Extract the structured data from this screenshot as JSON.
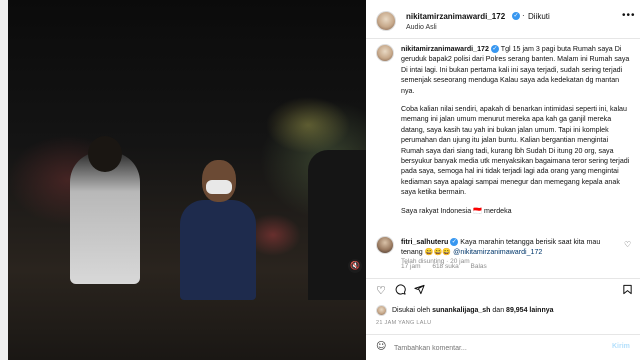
{
  "post": {
    "username": "nikitamirzanimawardi_172",
    "follow_label": "Diikuti",
    "audio_label": "Audio Asli",
    "more_label": "•••"
  },
  "caption": {
    "username": "nikitamirzanimawardi_172",
    "paragraphs": [
      "Tgl 15 jam 3 pagi buta Rumah saya Di geruduk bapak2 polisi dari Polres serang banten. Malam ini Rumah saya Di intai lagi. Ini bukan pertama kali ini saya terjadi, sudah sering terjadi semenjak seseorang menduga Kalau saya ada kedekatan dg mantan nya.",
      "Coba kalian nilai sendiri, apakah di benarkan intimidasi seperti ini, kalau memang ini jalan umum menurut mereka apa kah ga ganjil mereka datang, saya kasih tau yah ini bukan jalan umum. Tapi ini komplek perumahan dan ujung itu jalan buntu. Kalian bergantian mengintai Rumah saya dari siang tadi, kurang lbh Sudah Di itung 20 org, saya bersyukur banyak media utk menyaksikan bagaimana teror sering terjadi pada saya, semoga hal ini tidak terjadi lagi ada orang yang mengintai kediaman saya apalagi sampai menegur dan memegang kepala anak saya ketika bermain.",
      "Saya rakyat Indonesia"
    ],
    "flag_emoji": "🇮🇩",
    "closing": "merdeka",
    "meta": "Telah disunting · 20 jam"
  },
  "comment": {
    "username": "fitri_salhuteru",
    "text": "Kaya marahin tetangga berisik saat kita mau tenang",
    "emojis": "😄😄😄",
    "mention": "@nikitamirzanimawardi_172",
    "time": "17 jam",
    "likes": "618 suka",
    "reply": "Balas"
  },
  "likes": {
    "prefix": "Disukai oleh",
    "user": "sunankalijaga_sh",
    "middle": "dan",
    "count": "89,954 lainnya"
  },
  "time_ago": "21 JAM YANG LALU",
  "add_comment": {
    "placeholder": "Tambahkan komentar...",
    "post_label": "Kirim"
  },
  "icons": {
    "heart": "heart-icon",
    "comment": "comment-icon",
    "share": "share-icon",
    "save": "bookmark-icon",
    "emoji": "emoji-icon",
    "mute": "speaker-muted-icon"
  }
}
